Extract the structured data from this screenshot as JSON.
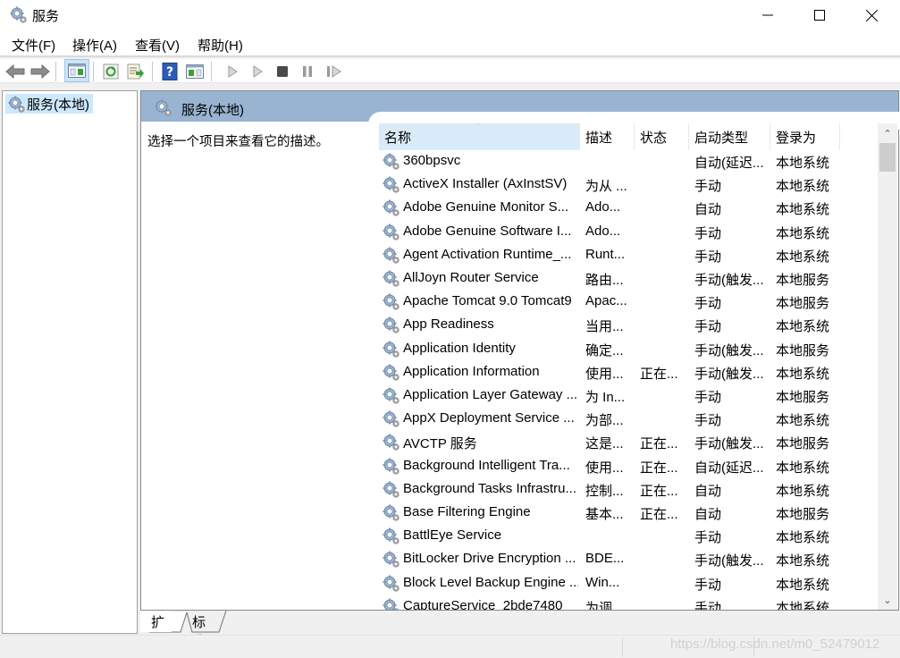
{
  "window": {
    "title": "服务",
    "icon": "services-gear-icon",
    "controls": {
      "minimize": "minimize-icon",
      "maximize": "maximize-icon",
      "close": "close-icon"
    }
  },
  "menu": [
    "文件(F)",
    "操作(A)",
    "查看(V)",
    "帮助(H)"
  ],
  "toolbar": [
    {
      "name": "back-button",
      "icon": "back-arrow-icon"
    },
    {
      "name": "forward-button",
      "icon": "forward-arrow-icon"
    },
    {
      "name": "show-hide-console-tree-button",
      "icon": "console-tree-icon",
      "active": true
    },
    {
      "name": "refresh-button",
      "icon": "refresh-icon"
    },
    {
      "name": "export-list-button",
      "icon": "export-list-icon"
    },
    {
      "name": "help-button",
      "icon": "help-icon"
    },
    {
      "name": "show-hide-action-pane-button",
      "icon": "action-pane-icon"
    },
    {
      "name": "start-service-button",
      "icon": "play-icon"
    },
    {
      "name": "start-service-alt-button",
      "icon": "play-icon"
    },
    {
      "name": "stop-service-button",
      "icon": "stop-icon"
    },
    {
      "name": "pause-service-button",
      "icon": "pause-icon"
    },
    {
      "name": "restart-service-button",
      "icon": "restart-icon"
    }
  ],
  "tree": {
    "selected": "服务(本地)"
  },
  "main": {
    "header": "服务(本地)",
    "description": "选择一个项目来查看它的描述。",
    "columns": [
      "名称",
      "描述",
      "状态",
      "启动类型",
      "登录为"
    ],
    "sorted_column": "名称",
    "rows": [
      {
        "name": "360bpsvc",
        "desc": "",
        "status": "",
        "startup": "自动(延迟...",
        "logon": "本地系统"
      },
      {
        "name": "ActiveX Installer (AxInstSV)",
        "desc": "为从 ...",
        "status": "",
        "startup": "手动",
        "logon": "本地系统"
      },
      {
        "name": "Adobe Genuine Monitor S...",
        "desc": "Ado...",
        "status": "",
        "startup": "自动",
        "logon": "本地系统"
      },
      {
        "name": "Adobe Genuine Software I...",
        "desc": "Ado...",
        "status": "",
        "startup": "手动",
        "logon": "本地系统"
      },
      {
        "name": "Agent Activation Runtime_...",
        "desc": "Runt...",
        "status": "",
        "startup": "手动",
        "logon": "本地系统"
      },
      {
        "name": "AllJoyn Router Service",
        "desc": "路由...",
        "status": "",
        "startup": "手动(触发...",
        "logon": "本地服务"
      },
      {
        "name": "Apache Tomcat 9.0 Tomcat9",
        "desc": "Apac...",
        "status": "",
        "startup": "手动",
        "logon": "本地服务"
      },
      {
        "name": "App Readiness",
        "desc": "当用...",
        "status": "",
        "startup": "手动",
        "logon": "本地系统"
      },
      {
        "name": "Application Identity",
        "desc": "确定...",
        "status": "",
        "startup": "手动(触发...",
        "logon": "本地服务"
      },
      {
        "name": "Application Information",
        "desc": "使用...",
        "status": "正在...",
        "startup": "手动(触发...",
        "logon": "本地系统"
      },
      {
        "name": "Application Layer Gateway ...",
        "desc": "为 In...",
        "status": "",
        "startup": "手动",
        "logon": "本地服务"
      },
      {
        "name": "AppX Deployment Service ...",
        "desc": "为部...",
        "status": "",
        "startup": "手动",
        "logon": "本地系统"
      },
      {
        "name": "AVCTP 服务",
        "desc": "这是...",
        "status": "正在...",
        "startup": "手动(触发...",
        "logon": "本地服务"
      },
      {
        "name": "Background Intelligent Tra...",
        "desc": "使用...",
        "status": "正在...",
        "startup": "自动(延迟...",
        "logon": "本地系统"
      },
      {
        "name": "Background Tasks Infrastru...",
        "desc": "控制...",
        "status": "正在...",
        "startup": "自动",
        "logon": "本地系统"
      },
      {
        "name": "Base Filtering Engine",
        "desc": "基本...",
        "status": "正在...",
        "startup": "自动",
        "logon": "本地服务"
      },
      {
        "name": "BattlEye Service",
        "desc": "",
        "status": "",
        "startup": "手动",
        "logon": "本地系统"
      },
      {
        "name": "BitLocker Drive Encryption ...",
        "desc": "BDE...",
        "status": "",
        "startup": "手动(触发...",
        "logon": "本地系统"
      },
      {
        "name": "Block Level Backup Engine ...",
        "desc": "Win...",
        "status": "",
        "startup": "手动",
        "logon": "本地系统"
      },
      {
        "name": "CaptureService_2bde7480",
        "desc": "为调...",
        "status": "",
        "startup": "手动",
        "logon": "本地系统"
      }
    ]
  },
  "tabs": [
    {
      "label": "扩展",
      "active": true
    },
    {
      "label": "标准",
      "active": false
    }
  ],
  "scrollbar": {
    "up": "^",
    "down": "v"
  },
  "watermark": "https://blog.csdn.net/m0_52479012"
}
